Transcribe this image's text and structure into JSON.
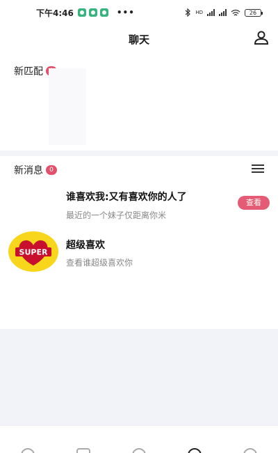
{
  "status_bar": {
    "time": "下午4:46",
    "dots": "•••",
    "signal_text": "HD",
    "battery": "26"
  },
  "header": {
    "title": "聊天",
    "profile_icon": "person-icon"
  },
  "new_matches": {
    "title": "新匹配",
    "count": "0"
  },
  "new_messages": {
    "title": "新消息",
    "count": "0",
    "menu_icon": "menu-icon",
    "items": [
      {
        "title": "谁喜欢我:又有喜欢你的人了",
        "subtitle": "最近的一个妹子仅距离你米",
        "button": "查看"
      },
      {
        "title": "超级喜欢",
        "subtitle": "查看谁超级喜欢你",
        "logo_text": "SUPER"
      }
    ]
  },
  "colors": {
    "accent": "#e35b74",
    "badge": "#e3506a",
    "super_bg": "#f7d61c",
    "super_heart": "#c8102e"
  }
}
